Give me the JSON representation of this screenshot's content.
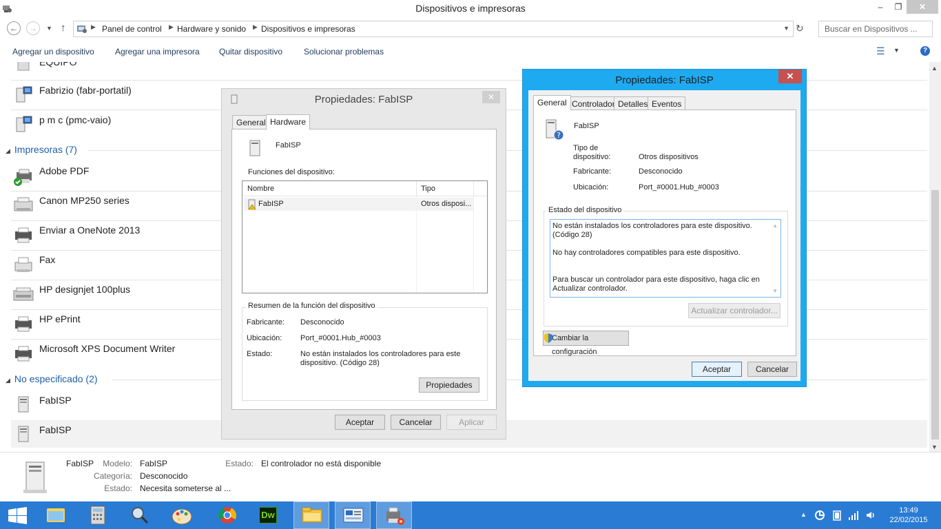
{
  "window": {
    "title": "Dispositivos e impresoras",
    "minimize": "–",
    "maximize": "❐",
    "close": "✕"
  },
  "address": {
    "crumbs": [
      "Panel de control",
      "Hardware y sonido",
      "Dispositivos e impresoras"
    ],
    "search_placeholder": "Buscar en Dispositivos ..."
  },
  "toolbar": {
    "add_device": "Agregar un dispositivo",
    "add_printer": "Agregar una impresora",
    "remove_device": "Quitar dispositivo",
    "troubleshoot": "Solucionar problemas",
    "help": "?"
  },
  "list": {
    "partial_top": "EQUIPO",
    "computers": [
      "Fabrizio (fabr-portatil)",
      "p m c (pmc-vaio)"
    ],
    "printers_group": "Impresoras (7)",
    "printers": [
      "Adobe PDF",
      "Canon MP250 series",
      "Enviar a OneNote 2013",
      "Fax",
      "HP designjet 100plus",
      "HP ePrint",
      "Microsoft XPS Document Writer"
    ],
    "unspecified_group": "No especificado (2)",
    "unspecified": [
      "FabISP",
      "FabISP"
    ]
  },
  "details": {
    "name": "FabISP",
    "model_label": "Modelo:",
    "model_value": "FabISP",
    "category_label": "Categoría:",
    "category_value": "Desconocido",
    "status_label": "Estado:",
    "status_value": "Necesita someterse al ...",
    "state_label": "Estado:",
    "state_value": "El controlador no está disponible"
  },
  "dialog1": {
    "title": "Propiedades: FabISP",
    "close": "✕",
    "tabs": [
      "General",
      "Hardware"
    ],
    "device_name": "FabISP",
    "functions_label": "Funciones del dispositivo:",
    "col_name": "Nombre",
    "col_type": "Tipo",
    "row_name": "FabISP",
    "row_type": "Otros disposi...",
    "summary_legend": "Resumen de la función del dispositivo",
    "manufacturer_label": "Fabricante:",
    "manufacturer_value": "Desconocido",
    "location_label": "Ubicación:",
    "location_value": "Port_#0001.Hub_#0003",
    "status_label": "Estado:",
    "status_value": "No están instalados los controladores para este dispositivo. (Código 28)",
    "properties_btn": "Propiedades",
    "ok": "Aceptar",
    "cancel": "Cancelar",
    "apply": "Aplicar"
  },
  "dialog2": {
    "title": "Propiedades: FabISP",
    "close": "✕",
    "tabs": [
      "General",
      "Controlador",
      "Detalles",
      "Eventos"
    ],
    "device_name": "FabISP",
    "type_label": "Tipo de dispositivo:",
    "type_value": "Otros dispositivos",
    "manufacturer_label": "Fabricante:",
    "manufacturer_value": "Desconocido",
    "location_label": "Ubicación:",
    "location_value": "Port_#0001.Hub_#0003",
    "status_legend": "Estado del dispositivo",
    "status_line1": "No están instalados los controladores para este dispositivo. (Código 28)",
    "status_line2": "No hay controladores compatibles para este dispositivo.",
    "status_line3": "Para buscar un controlador para este dispositivo, haga clic en Actualizar controlador.",
    "update_driver": "Actualizar controlador...",
    "change_settings": "Cambiar la configuración",
    "ok": "Aceptar",
    "cancel": "Cancelar"
  },
  "taskbar": {
    "apps": [
      "start",
      "explorer",
      "calculator",
      "magnifier",
      "paint",
      "chrome",
      "dreamweaver",
      "file-explorer",
      "control-panel",
      "devices"
    ],
    "dw_label": "Dw",
    "time": "13:49",
    "date": "22/02/2015"
  },
  "colors": {
    "accent": "#1eaaf1",
    "taskbar": "#2a7bd4",
    "group_link": "#1e5fa3",
    "close_red": "#c75050"
  }
}
